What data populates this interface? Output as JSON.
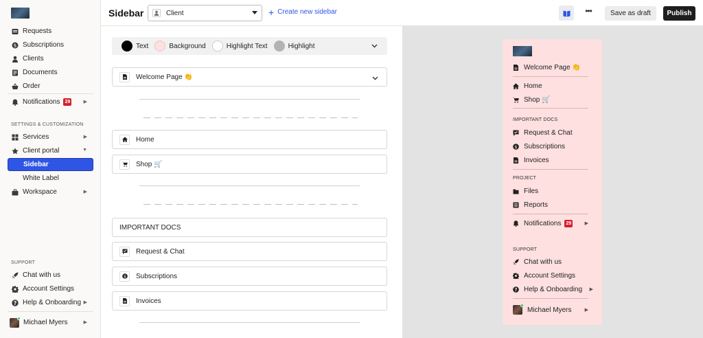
{
  "nav": {
    "items": [
      {
        "label": "Requests",
        "icon": "requests-icon"
      },
      {
        "label": "Subscriptions",
        "icon": "subscriptions-icon"
      },
      {
        "label": "Clients",
        "icon": "user-icon"
      },
      {
        "label": "Documents",
        "icon": "documents-icon"
      },
      {
        "label": "Order",
        "icon": "basket-icon"
      },
      {
        "label": "Notifications",
        "icon": "bell-icon",
        "badge": "29"
      }
    ],
    "settings_section": "SETTINGS & CUSTOMIZATION",
    "settings_items": [
      {
        "label": "Services",
        "icon": "grid-icon"
      },
      {
        "label": "Client portal",
        "icon": "star-icon"
      },
      {
        "label": "Sidebar"
      },
      {
        "label": "White Label"
      },
      {
        "label": "Workspace",
        "icon": "briefcase-icon"
      }
    ],
    "support_section": "SUPPORT",
    "support_items": [
      {
        "label": "Chat with us",
        "icon": "rocket-icon"
      },
      {
        "label": "Account Settings",
        "icon": "gear-icon"
      },
      {
        "label": "Help & Onboarding",
        "icon": "help-icon"
      }
    ],
    "user": "Michael Myers"
  },
  "topbar": {
    "title": "Sidebar",
    "select_value": "Client",
    "new_sidebar": "Create new sidebar",
    "more": "•••",
    "draft": "Save as draft",
    "publish": "Publish"
  },
  "editor": {
    "colors": [
      {
        "label": "Text",
        "color": "#000000"
      },
      {
        "label": "Background",
        "color": "#fde0df"
      },
      {
        "label": "Highlight Text",
        "color": "#ffffff"
      },
      {
        "label": "Highlight",
        "color": "#b3b3b3"
      }
    ],
    "welcome": "Welcome Page 👏",
    "home": "Home",
    "shop": "Shop 🛒",
    "important_docs": "IMPORTANT DOCS",
    "request_chat": "Request & Chat",
    "subscriptions": "Subscriptions",
    "invoices": "Invoices"
  },
  "preview": {
    "welcome": "Welcome Page 👏",
    "home": "Home",
    "shop": "Shop 🛒",
    "important_docs": "IMPORTANT DOCS",
    "request_chat": "Request & Chat",
    "subscriptions": "Subscriptions",
    "invoices": "Invoices",
    "project": "PROJECT",
    "files": "Files",
    "reports": "Reports",
    "notifications": "Notifications",
    "notifications_badge": "29",
    "support": "SUPPORT",
    "chat": "Chat with us",
    "account": "Account Settings",
    "help": "Help & Onboarding",
    "user": "Michael Myers"
  },
  "colors": {
    "accent": "#2f55e4",
    "badge": "#d4202c",
    "preview_bg": "#fde0df"
  }
}
